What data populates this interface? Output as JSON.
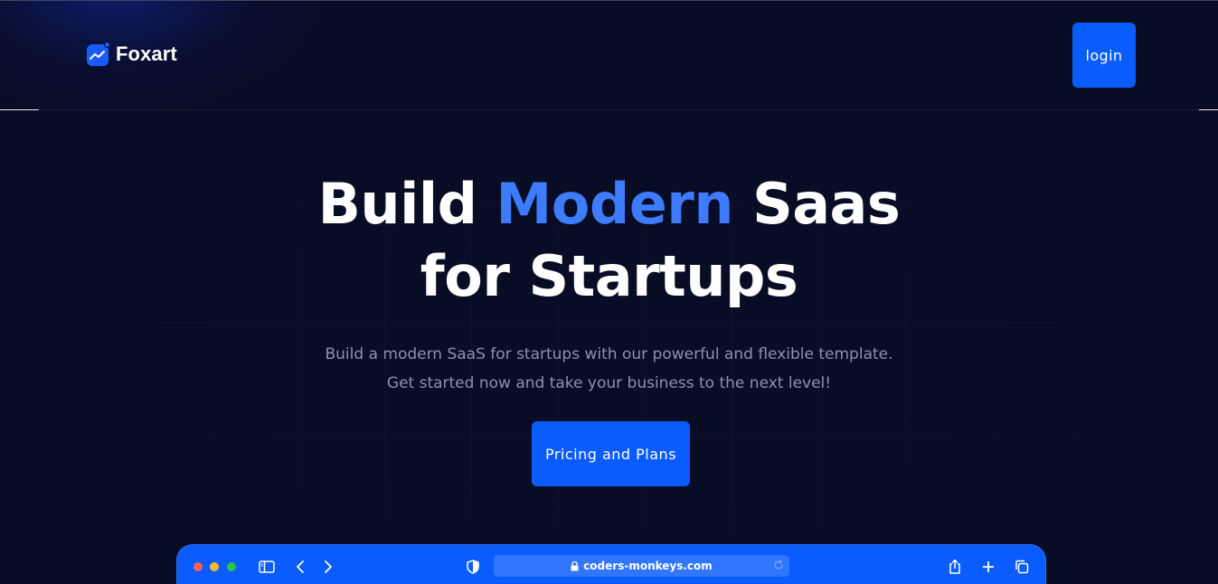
{
  "brand": {
    "name": "Foxart",
    "icon": "chart-logo-icon"
  },
  "header": {
    "login_label": "login"
  },
  "hero": {
    "title_part1": "Build ",
    "title_accent": "Modern",
    "title_part2": " Saas",
    "title_line2": "for Startups",
    "subtitle_line1": "Build a modern SaaS for startups with our powerful and flexible template.",
    "subtitle_line2": "Get started now and take your business to the next level!",
    "cta_label": "Pricing and Plans"
  },
  "browser_mockup": {
    "url": "coders-monkeys.com",
    "icons": [
      "sidebar-icon",
      "back-icon",
      "forward-icon",
      "shield-icon",
      "lock-icon",
      "reload-icon",
      "share-icon",
      "new-tab-icon",
      "tabs-icon"
    ]
  },
  "colors": {
    "background": "#080d25",
    "primary": "#0a5cff",
    "accent_text": "#3d7bff",
    "muted_text": "#8a93ad"
  }
}
